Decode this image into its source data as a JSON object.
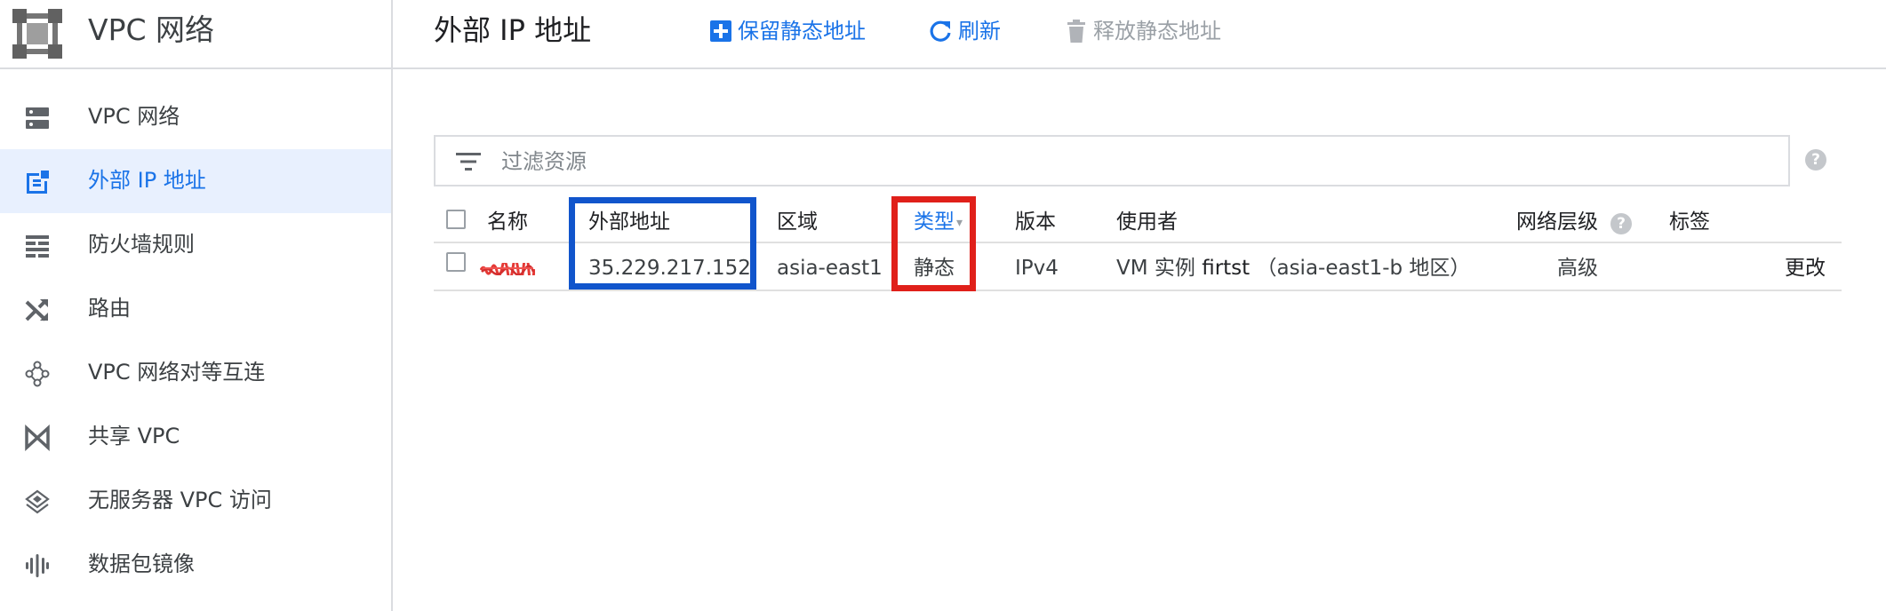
{
  "sidebar": {
    "title": "VPC 网络",
    "logo_icon": "vpc-network-logo-icon",
    "items": [
      {
        "label": "VPC 网络",
        "icon": "vpc-network-icon",
        "active": false
      },
      {
        "label": "外部 IP 地址",
        "icon": "external-ip-icon",
        "active": true
      },
      {
        "label": "防火墙规则",
        "icon": "firewall-icon",
        "active": false
      },
      {
        "label": "路由",
        "icon": "routes-icon",
        "active": false
      },
      {
        "label": "VPC 网络对等互连",
        "icon": "peering-icon",
        "active": false
      },
      {
        "label": "共享 VPC",
        "icon": "shared-vpc-icon",
        "active": false
      },
      {
        "label": "无服务器 VPC 访问",
        "icon": "serverless-vpc-icon",
        "active": false
      },
      {
        "label": "数据包镜像",
        "icon": "packet-mirroring-icon",
        "active": false
      }
    ]
  },
  "header": {
    "title": "外部 IP 地址",
    "actions": {
      "reserve": "保留静态地址",
      "refresh": "刷新",
      "release": "释放静态地址"
    }
  },
  "filter": {
    "placeholder": "过滤资源"
  },
  "table": {
    "columns": {
      "name": "名称",
      "external_address": "外部地址",
      "region": "区域",
      "type": "类型",
      "version": "版本",
      "user": "使用者",
      "network_tier": "网络层级",
      "labels": "标签"
    },
    "rows": [
      {
        "external_address": "35.229.217.152",
        "region": "asia-east1",
        "type": "静态",
        "version": "IPv4",
        "user_prefix": "VM 实例",
        "user_instance": "firtst",
        "user_zone": "（asia-east1-b 地区）",
        "network_tier": "高级",
        "action": "更改"
      }
    ]
  },
  "colors": {
    "accent": "#1a73e8",
    "active_bg": "#e8f0fe",
    "highlight_blue": "#1155cc",
    "highlight_red": "#e0201a"
  }
}
